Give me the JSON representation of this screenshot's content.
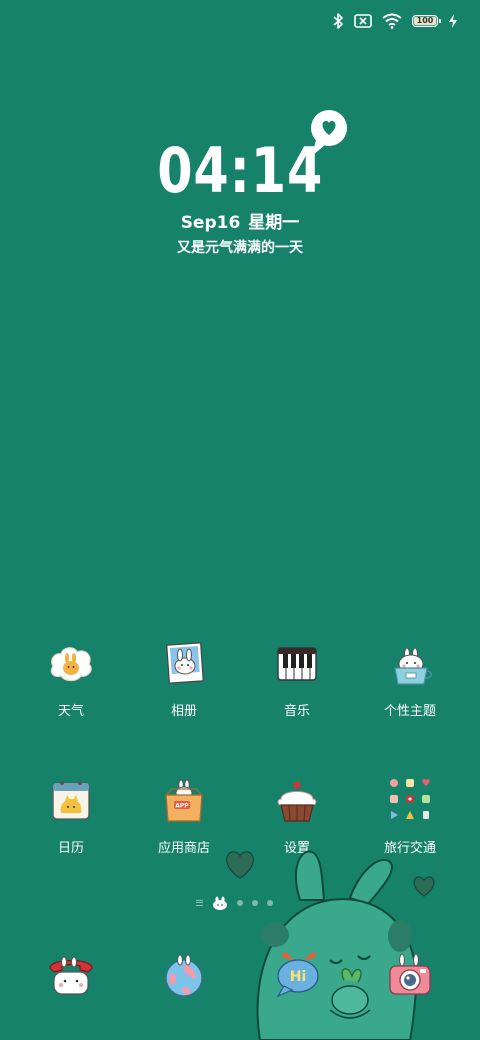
{
  "status_bar": {
    "icons": [
      "bluetooth-icon",
      "no-sim-icon",
      "wifi-icon",
      "battery-icon",
      "charging-icon"
    ],
    "battery_level": "100"
  },
  "clock": {
    "time": "04:14",
    "date": "Sep16",
    "weekday": "星期一",
    "slogan": "又是元气满满的一天"
  },
  "apps": [
    {
      "label": "天气",
      "icon": "weather-icon"
    },
    {
      "label": "相册",
      "icon": "gallery-icon"
    },
    {
      "label": "音乐",
      "icon": "music-icon"
    },
    {
      "label": "个性主题",
      "icon": "themes-icon"
    },
    {
      "label": "日历",
      "icon": "calendar-icon"
    },
    {
      "label": "应用商店",
      "icon": "app-store-icon"
    },
    {
      "label": "设置",
      "icon": "settings-icon"
    },
    {
      "label": "旅行交通",
      "icon": "travel-folder-icon"
    }
  ],
  "dock": [
    {
      "icon": "phone-icon"
    },
    {
      "icon": "browser-icon"
    },
    {
      "icon": "messages-icon",
      "text": "Hi"
    },
    {
      "icon": "camera-icon"
    }
  ],
  "colors": {
    "background": "#16826a",
    "bunny": "#3aa88c",
    "text": "#ffffff"
  }
}
